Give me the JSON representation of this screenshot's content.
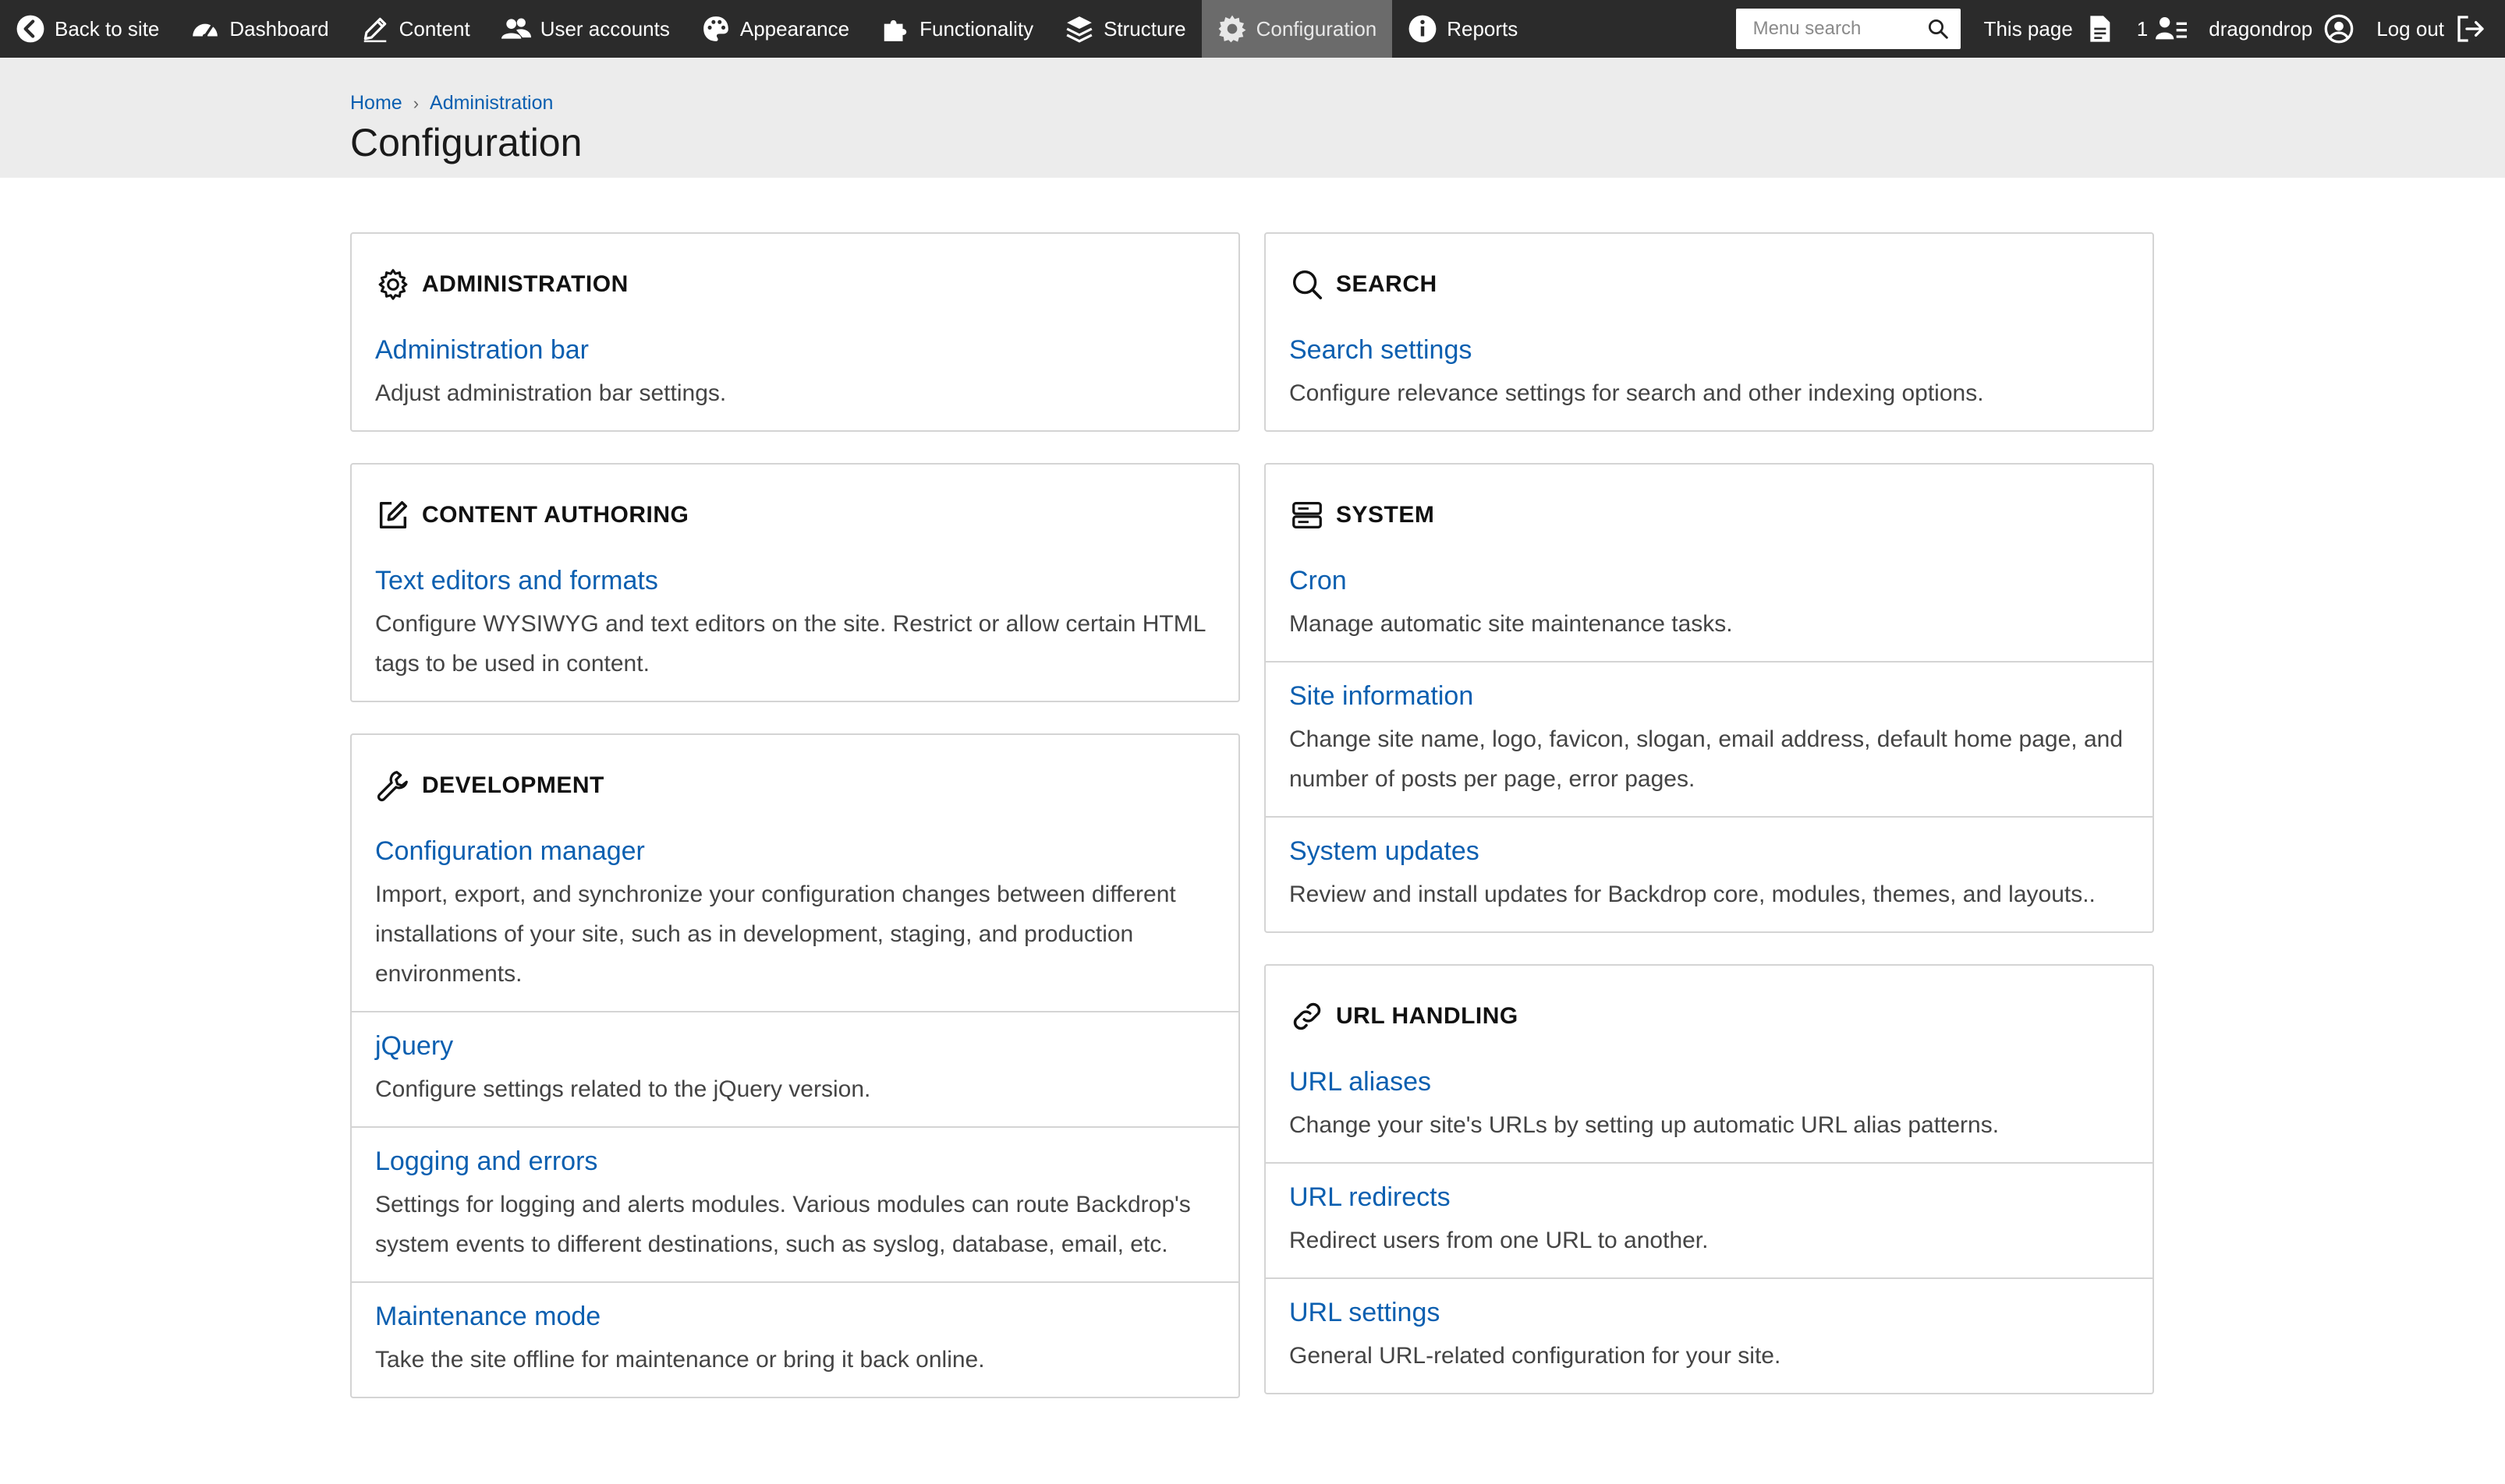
{
  "toolbar": {
    "items": [
      {
        "label": "Back to site",
        "icon": "back-arrow-icon"
      },
      {
        "label": "Dashboard",
        "icon": "dashboard-icon"
      },
      {
        "label": "Content",
        "icon": "pencil-icon"
      },
      {
        "label": "User accounts",
        "icon": "users-icon"
      },
      {
        "label": "Appearance",
        "icon": "palette-icon"
      },
      {
        "label": "Functionality",
        "icon": "puzzle-icon"
      },
      {
        "label": "Structure",
        "icon": "layers-icon"
      },
      {
        "label": "Configuration",
        "icon": "gear-icon"
      },
      {
        "label": "Reports",
        "icon": "info-icon"
      }
    ],
    "active_item": "Configuration",
    "search_placeholder": "Menu search",
    "this_page": "This page",
    "user_count": "1",
    "username": "dragondrop",
    "logout": "Log out"
  },
  "header": {
    "breadcrumb": [
      "Home",
      "Administration"
    ],
    "title": "Configuration"
  },
  "panels": {
    "administration": {
      "title": "ADMINISTRATION",
      "icon": "gear-icon",
      "entries": [
        {
          "link": "Administration bar",
          "desc": "Adjust administration bar settings."
        }
      ]
    },
    "content_authoring": {
      "title": "CONTENT AUTHORING",
      "icon": "edit-icon",
      "entries": [
        {
          "link": "Text editors and formats",
          "desc": "Configure WYSIWYG and text editors on the site. Restrict or allow certain HTML tags to be used in content."
        }
      ]
    },
    "development": {
      "title": "DEVELOPMENT",
      "icon": "wrench-icon",
      "entries": [
        {
          "link": "Configuration manager",
          "desc": "Import, export, and synchronize your configuration changes between different installations of your site, such as in development, staging, and production environments."
        },
        {
          "link": "jQuery",
          "desc": "Configure settings related to the jQuery version."
        },
        {
          "link": "Logging and errors",
          "desc": "Settings for logging and alerts modules. Various modules can route Backdrop's system events to different destinations, such as syslog, database, email, etc."
        },
        {
          "link": "Maintenance mode",
          "desc": "Take the site offline for maintenance or bring it back online."
        }
      ]
    },
    "search": {
      "title": "SEARCH",
      "icon": "magnifier-icon",
      "entries": [
        {
          "link": "Search settings",
          "desc": "Configure relevance settings for search and other indexing options."
        }
      ]
    },
    "system": {
      "title": "SYSTEM",
      "icon": "server-icon",
      "entries": [
        {
          "link": "Cron",
          "desc": "Manage automatic site maintenance tasks."
        },
        {
          "link": "Site information",
          "desc": "Change site name, logo, favicon, slogan, email address, default home page, and number of posts per page, error pages."
        },
        {
          "link": "System updates",
          "desc": "Review and install updates for Backdrop core, modules, themes, and layouts.."
        }
      ]
    },
    "url_handling": {
      "title": "URL HANDLING",
      "icon": "link-icon",
      "entries": [
        {
          "link": "URL aliases",
          "desc": "Change your site's URLs by setting up automatic URL alias patterns."
        },
        {
          "link": "URL redirects",
          "desc": "Redirect users from one URL to another."
        },
        {
          "link": "URL settings",
          "desc": "General URL-related configuration for your site."
        }
      ]
    }
  },
  "colors": {
    "toolbar_bg": "#2b2b2b",
    "toolbar_active": "#6b6b6b",
    "header_bg": "#ececec",
    "link": "#0b5fb0",
    "border": "#d4d4d4"
  }
}
